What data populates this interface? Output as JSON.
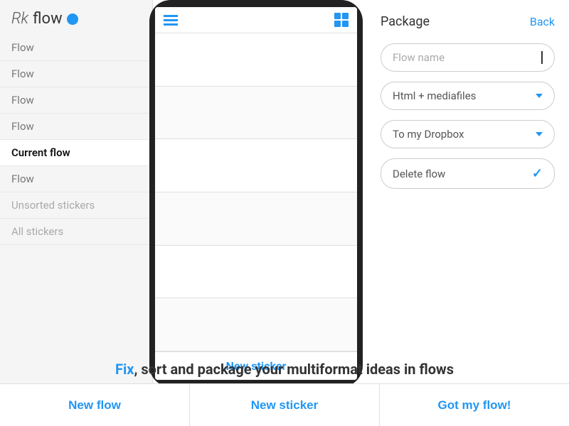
{
  "logo": {
    "rk": "Rk",
    "flow": "flow"
  },
  "sidebar": {
    "items": [
      {
        "label": "Flow",
        "state": "normal"
      },
      {
        "label": "Flow",
        "state": "normal"
      },
      {
        "label": "Flow",
        "state": "normal"
      },
      {
        "label": "Flow",
        "state": "normal"
      },
      {
        "label": "Current flow",
        "state": "active"
      },
      {
        "label": "Flow",
        "state": "normal"
      },
      {
        "label": "Unsorted stickers",
        "state": "muted"
      },
      {
        "label": "All stickers",
        "state": "muted"
      }
    ]
  },
  "phone": {
    "new_sticker_label": "New sticker"
  },
  "right_panel": {
    "title": "Package",
    "back_label": "Back",
    "flow_name_placeholder": "Flow name",
    "format_label": "Html + mediafiles",
    "destination_label": "To my Dropbox",
    "delete_label": "Delete flow"
  },
  "bottom": {
    "new_flow_label": "New flow",
    "new_sticker_label": "New sticker",
    "got_flow_label": "Got my flow!"
  },
  "tagline": {
    "fix": "Fix",
    "rest": ", sort and package your multiformat ideas in flows"
  }
}
